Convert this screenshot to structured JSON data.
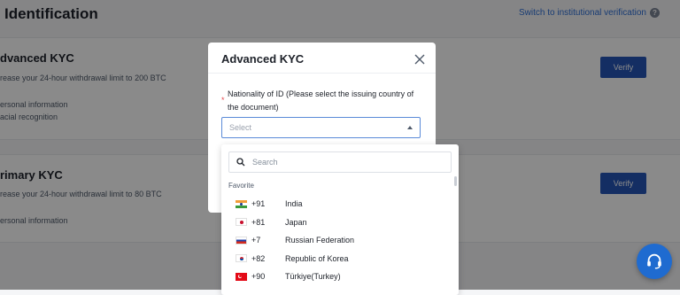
{
  "page": {
    "title": "Identification",
    "switch_link": "Switch to institutional verification",
    "help_glyph": "?"
  },
  "cards": {
    "advanced": {
      "title": "dvanced KYC",
      "desc": "rease your 24-hour withdrawal limit to 200 BTC",
      "req1": "ersonal information",
      "req2": "acial recognition",
      "verify": "Verify"
    },
    "primary": {
      "title": "rimary KYC",
      "desc": "rease your 24-hour withdrawal limit to 80 BTC",
      "req1": "ersonal information",
      "verify": "Verify"
    }
  },
  "modal": {
    "title": "Advanced KYC",
    "required_mark": "*",
    "field_label": "Nationality of ID (Please select the issuing country of the document)",
    "select_placeholder": "Select"
  },
  "dropdown": {
    "search_placeholder": "Search",
    "section": "Favorite",
    "items": [
      {
        "dial": "+91",
        "country": "India",
        "flag": "india-flag"
      },
      {
        "dial": "+81",
        "country": "Japan",
        "flag": "japan-flag"
      },
      {
        "dial": "+7",
        "country": "Russian Federation",
        "flag": "russia-flag"
      },
      {
        "dial": "+82",
        "country": "Republic of Korea",
        "flag": "korea-flag"
      },
      {
        "dial": "+90",
        "country": "Türkiye(Turkey)",
        "flag": "turkey-flag"
      }
    ]
  },
  "colors": {
    "accent": "#2656b8",
    "link": "#2f6fd6",
    "required": "#e5484d"
  }
}
